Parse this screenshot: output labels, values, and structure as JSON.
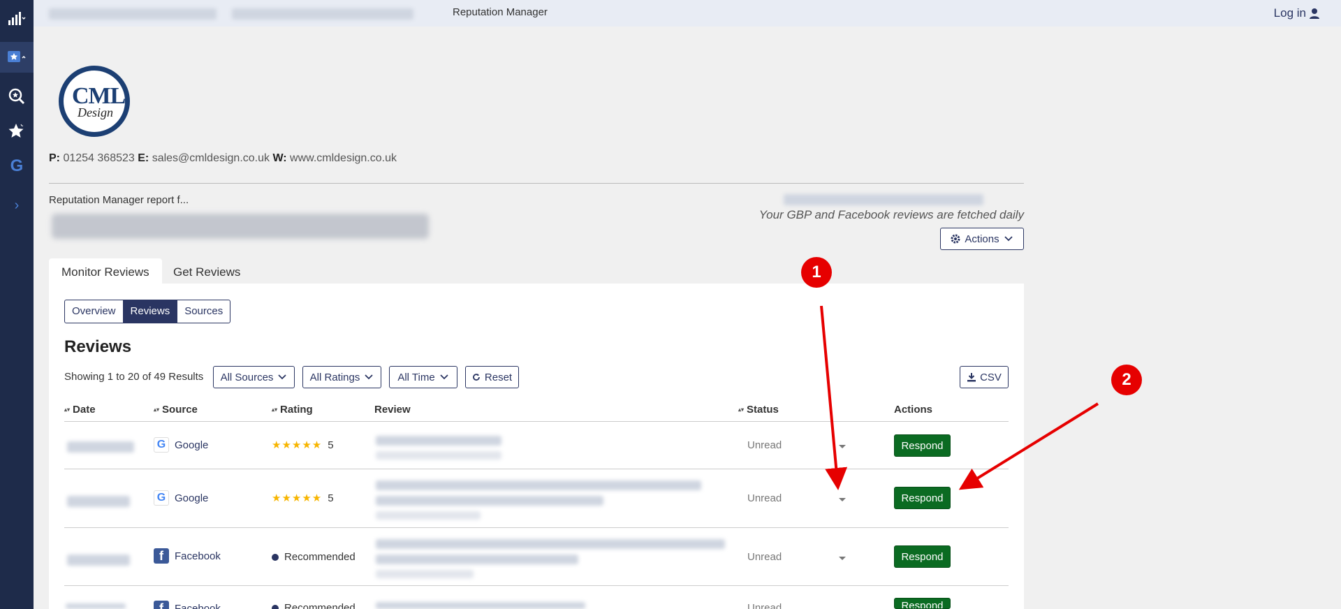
{
  "topbar": {
    "title": "Reputation Manager",
    "login": "Log in"
  },
  "logo": {
    "line1": "CML",
    "line2": "Design"
  },
  "contact": {
    "p_label": "P:",
    "phone": "01254 368523",
    "e_label": "E:",
    "email": "sales@cmldesign.co.uk",
    "w_label": "W:",
    "website": "www.cmldesign.co.uk"
  },
  "report": {
    "for_label": "Reputation Manager report f...",
    "fetched_note": "Your GBP and Facebook reviews are fetched daily",
    "actions_label": "Actions"
  },
  "main_tabs": [
    {
      "label": "Monitor Reviews",
      "active": true
    },
    {
      "label": "Get Reviews",
      "active": false
    }
  ],
  "sub_tabs": [
    {
      "label": "Overview",
      "active": false
    },
    {
      "label": "Reviews",
      "active": true
    },
    {
      "label": "Sources",
      "active": false
    }
  ],
  "reviews": {
    "heading": "Reviews",
    "showing": "Showing 1 to 20 of 49 Results",
    "filters": {
      "sources": "All Sources",
      "ratings": "All Ratings",
      "time": "All Time",
      "reset": "Reset"
    },
    "csv_label": "CSV",
    "columns": {
      "date": "Date",
      "source": "Source",
      "rating": "Rating",
      "review": "Review",
      "status": "Status",
      "actions": "Actions"
    },
    "rows": [
      {
        "source": "Google",
        "source_icon": "google-icon",
        "stars": "★★★★★",
        "rating": "5",
        "status": "Unread",
        "action": "Respond"
      },
      {
        "source": "Google",
        "source_icon": "google-icon",
        "stars": "★★★★★",
        "rating": "5",
        "status": "Unread",
        "action": "Respond"
      },
      {
        "source": "Facebook",
        "source_icon": "facebook-icon",
        "rating": "Recommended",
        "status": "Unread",
        "action": "Respond"
      },
      {
        "source": "Facebook",
        "source_icon": "facebook-icon",
        "rating": "Recommended",
        "status": "Unread",
        "action": "Respond"
      }
    ]
  },
  "annotations": {
    "marker1": "1",
    "marker2": "2"
  },
  "colors": {
    "nav": "#1e2b4a",
    "primary": "#2a3562",
    "respond": "#0b6b22",
    "annotation": "#e60000"
  }
}
